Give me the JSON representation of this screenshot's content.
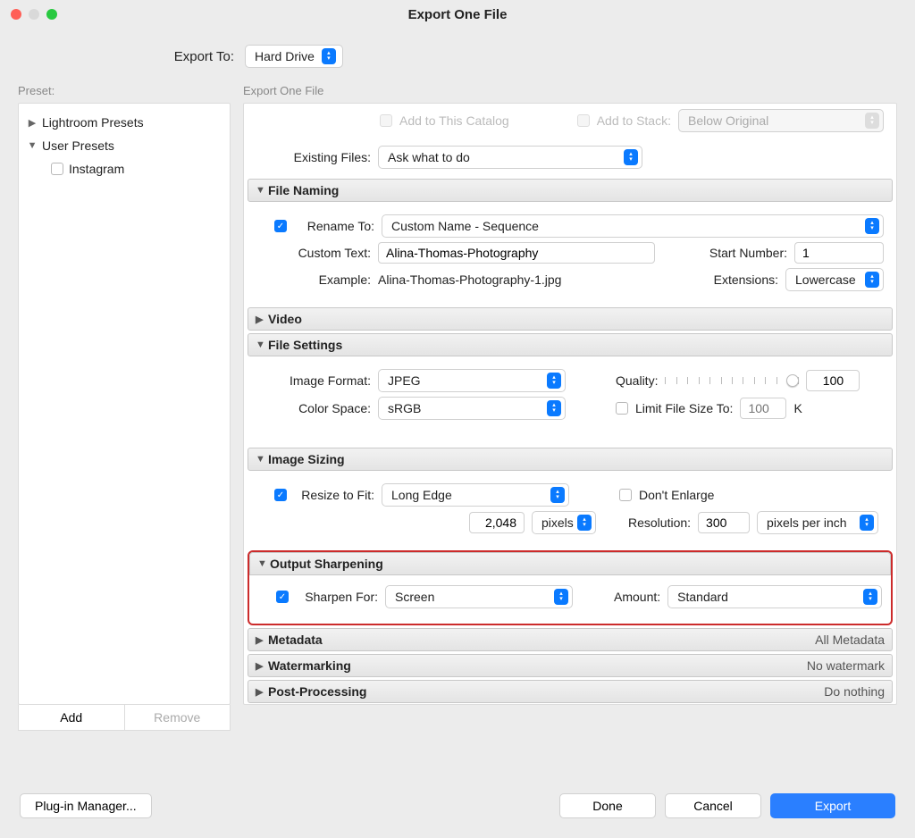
{
  "window": {
    "title": "Export One File"
  },
  "exportTo": {
    "label": "Export To:",
    "value": "Hard Drive"
  },
  "sidebar": {
    "header": "Preset:",
    "lightroomPresets": "Lightroom Presets",
    "userPresets": "User Presets",
    "instagram": "Instagram",
    "addBtn": "Add",
    "removeBtn": "Remove"
  },
  "main": {
    "header": "Export One File",
    "catalog": {
      "addToCatalog": "Add to This Catalog",
      "addToStack": "Add to Stack:",
      "stackValue": "Below Original",
      "existingLabel": "Existing Files:",
      "existingValue": "Ask what to do"
    },
    "fileNaming": {
      "title": "File Naming",
      "renameLabel": "Rename To:",
      "renameValue": "Custom Name - Sequence",
      "customTextLabel": "Custom Text:",
      "customTextValue": "Alina-Thomas-Photography",
      "startNumLabel": "Start Number:",
      "startNumValue": "1",
      "exampleLabel": "Example:",
      "exampleValue": "Alina-Thomas-Photography-1.jpg",
      "extLabel": "Extensions:",
      "extValue": "Lowercase"
    },
    "video": {
      "title": "Video"
    },
    "fileSettings": {
      "title": "File Settings",
      "formatLabel": "Image Format:",
      "formatValue": "JPEG",
      "qualityLabel": "Quality:",
      "qualityValue": "100",
      "colorLabel": "Color Space:",
      "colorValue": "sRGB",
      "limitLabel": "Limit File Size To:",
      "limitValue": "100",
      "limitUnit": "K"
    },
    "sizing": {
      "title": "Image Sizing",
      "resizeLabel": "Resize to Fit:",
      "resizeValue": "Long Edge",
      "dontEnlarge": "Don't Enlarge",
      "dimValue": "2,048",
      "dimUnit": "pixels",
      "resLabel": "Resolution:",
      "resValue": "300",
      "resUnit": "pixels per inch"
    },
    "sharpen": {
      "title": "Output Sharpening",
      "sharpenLabel": "Sharpen For:",
      "sharpenValue": "Screen",
      "amountLabel": "Amount:",
      "amountValue": "Standard"
    },
    "metadata": {
      "title": "Metadata",
      "summary": "All Metadata"
    },
    "watermark": {
      "title": "Watermarking",
      "summary": "No watermark"
    },
    "post": {
      "title": "Post-Processing",
      "summary": "Do nothing"
    }
  },
  "footer": {
    "plugin": "Plug-in Manager...",
    "done": "Done",
    "cancel": "Cancel",
    "export": "Export"
  }
}
